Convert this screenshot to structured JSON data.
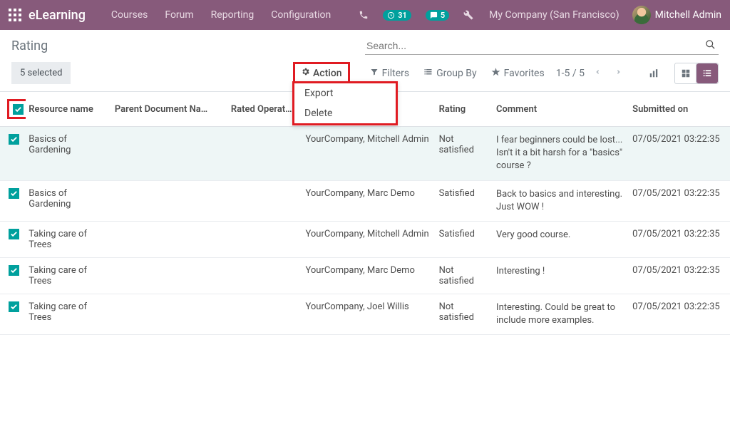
{
  "navbar": {
    "brand": "eLearning",
    "menu": [
      "Courses",
      "Forum",
      "Reporting",
      "Configuration"
    ],
    "activities_count": "31",
    "messages_count": "5",
    "company": "My Company (San Francisco)",
    "user": "Mitchell Admin"
  },
  "page": {
    "title": "Rating",
    "search_placeholder": "Search...",
    "selected_label": "5 selected",
    "action_label": "Action",
    "action_menu": {
      "export": "Export",
      "delete": "Delete"
    },
    "filters_label": "Filters",
    "group_by_label": "Group By",
    "favorites_label": "Favorites",
    "pager_label": "1-5 / 5"
  },
  "columns": {
    "resource": "Resource name",
    "parent": "Parent Document Na…",
    "operator": "Rated Operat…",
    "partner": "",
    "rating": "Rating",
    "comment": "Comment",
    "submitted": "Submitted on"
  },
  "ratings": {
    "satisfied": "Satisfied",
    "not_satisfied": "Not satisfied"
  },
  "rows": [
    {
      "resource": "Basics of Gardening",
      "partner": "YourCompany, Mitchell Admin",
      "rating_key": "not_satisfied",
      "comment": "I fear beginners could be lost... Isn't it a bit harsh for a \"basics\" course ?",
      "date": "07/05/2021 03:22:35",
      "highlight": true
    },
    {
      "resource": "Basics of Gardening",
      "partner": "YourCompany, Marc Demo",
      "rating_key": "satisfied",
      "comment": "Back to basics and interesting. Just WOW !",
      "date": "07/05/2021 03:22:35"
    },
    {
      "resource": "Taking care of Trees",
      "partner": "YourCompany, Mitchell Admin",
      "rating_key": "satisfied",
      "comment": "Very good course.",
      "date": "07/05/2021 03:22:35"
    },
    {
      "resource": "Taking care of Trees",
      "partner": "YourCompany, Marc Demo",
      "rating_key": "not_satisfied",
      "comment": "Interesting !",
      "date": "07/05/2021 03:22:35"
    },
    {
      "resource": "Taking care of Trees",
      "partner": "YourCompany, Joel Willis",
      "rating_key": "not_satisfied",
      "comment": "Interesting. Could be great to include more examples.",
      "date": "07/05/2021 03:22:35"
    }
  ]
}
